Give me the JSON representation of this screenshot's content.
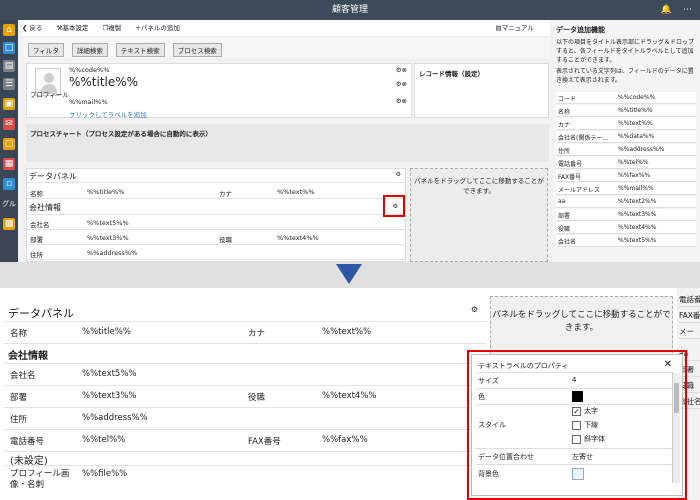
{
  "app": {
    "title": "顧客管理"
  },
  "toolbar": {
    "back": "戻る",
    "basic": "基本設定",
    "copy": "複製",
    "add_panel": "パネルの追加",
    "manual": "マニュアル"
  },
  "filters": [
    "フィルタ",
    "詳細検索",
    "テキスト検索",
    "プロセス検索"
  ],
  "profile": {
    "avatar_label": "プロフィール",
    "code": "%%code%%",
    "title": "%%title%%",
    "mail": "%%mail%%",
    "add_label": "クリックしてラベルを追加"
  },
  "record_info": "レコード情報（設定）",
  "process_chart": "プロセスチャート（プロセス設定がある場合に自動的に表示）",
  "top_panel": {
    "title": "データパネル",
    "row1": {
      "l1": "名称",
      "v1": "%%title%%",
      "l2": "カナ",
      "v2": "%%text%%"
    },
    "section": "会社情報",
    "row2": {
      "l1": "会社名",
      "v1": "%%text5%%"
    },
    "row3": {
      "l1": "部署",
      "v1": "%%text3%%",
      "l2": "役職",
      "v2": "%%text4%%"
    },
    "row4": {
      "l1": "住所",
      "v1": "%%address%%"
    }
  },
  "drop_hint": "パネルをドラッグしてここに移動することができます。",
  "info": {
    "title": "データ追加機能",
    "desc": "以下の項目をタイトル表示部にドラッグ＆ドロップすると、各フィールドをタイトルラベルとして追加することができます。",
    "desc2": "表示されている文字列は、フィールドのデータに置き換えて表示されます。",
    "items": [
      {
        "k": "コード",
        "v": "%%code%%"
      },
      {
        "k": "名称",
        "v": "%%title%%"
      },
      {
        "k": "カナ",
        "v": "%%text%%"
      },
      {
        "k": "会社名(関係テー...",
        "v": "%%data%%"
      },
      {
        "k": "住所",
        "v": "%%address%%"
      },
      {
        "k": "電話番号",
        "v": "%%tel%%"
      },
      {
        "k": "FAX番号",
        "v": "%%fax%%"
      },
      {
        "k": "メールアドレス",
        "v": "%%mail%%"
      },
      {
        "k": "aa",
        "v": "%%text2%%"
      },
      {
        "k": "部署",
        "v": "%%text3%%"
      },
      {
        "k": "役職",
        "v": "%%text4%%"
      },
      {
        "k": "会社名",
        "v": "%%text5%%"
      }
    ]
  },
  "nav_icons": [
    "home-icon",
    "chat-icon",
    "document-icon",
    "list-icon",
    "bag-icon",
    "mail-icon",
    "folder-icon",
    "calendar-icon",
    "message-icon",
    "group-icon"
  ],
  "nav_group_label": "グル",
  "bottom_panel": {
    "title": "データパネル",
    "row1": {
      "l1": "名称",
      "v1": "%%title%%",
      "l2": "カナ",
      "v2": "%%text%%"
    },
    "section": "会社情報",
    "row2": {
      "l1": "会社名",
      "v1": "%%text5%%"
    },
    "row3": {
      "l1": "部署",
      "v1": "%%text3%%",
      "l2": "役職",
      "v2": "%%text4%%"
    },
    "row4": {
      "l1": "住所",
      "v1": "%%address%%"
    },
    "row5": {
      "l1": "電話番号",
      "v1": "%%tel%%",
      "l2": "FAX番号",
      "v2": "%%fax%%"
    },
    "unset": "(未設定)",
    "row6": {
      "l1": "プロフィール画像・名刺",
      "v1": "%%file%%"
    }
  },
  "bottom_right_items": [
    "電話番",
    "FAX番",
    "メー",
    "aa",
    "部署",
    "役職",
    "会社名"
  ],
  "dialog": {
    "title": "テキストラベルのプロパティ",
    "size_label": "サイズ",
    "size_value": "4",
    "color_label": "色",
    "color_value": "#000000",
    "style_label": "スタイル",
    "bold": "太字",
    "bold_checked": true,
    "underline": "下線",
    "underline_checked": false,
    "italic": "斜字体",
    "italic_checked": false,
    "align_label": "データ位置合わせ",
    "align_value": "左寄せ",
    "bg_label": "背景色"
  },
  "colors": {
    "highlight": "#e00000",
    "arrow": "#2f56a5",
    "nav": "#3a4656"
  }
}
